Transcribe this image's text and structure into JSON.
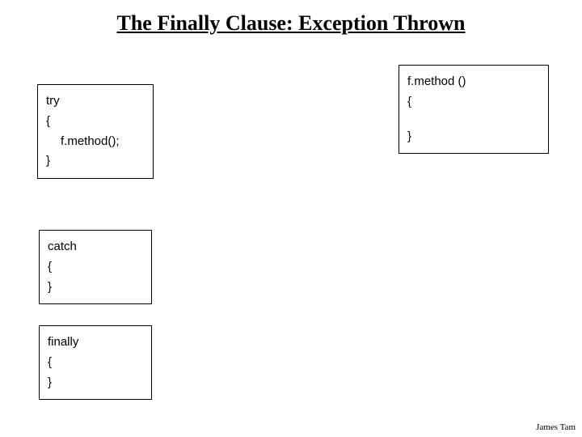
{
  "title": "The Finally Clause: Exception Thrown",
  "try_box": {
    "l1": "try",
    "l2": "{",
    "l3": "f.method();",
    "l4": "}"
  },
  "catch_box": {
    "l1": "catch",
    "l2": "{",
    "l3": "}"
  },
  "finally_box": {
    "l1": "finally",
    "l2": "{",
    "l3": "}"
  },
  "method_box": {
    "l1": "f.method ()",
    "l2": "{",
    "l3": "}"
  },
  "footer": "James Tam"
}
